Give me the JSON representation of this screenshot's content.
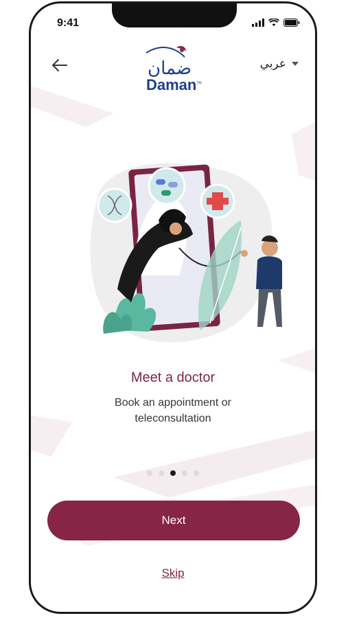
{
  "status_bar": {
    "time": "9:41",
    "icons": [
      "signal-icon",
      "wifi-icon",
      "battery-icon"
    ]
  },
  "header": {
    "back_icon": "arrow-left-icon",
    "logo": {
      "arabic": "ضمان",
      "english": "Daman",
      "trademark": "TM"
    },
    "language": {
      "label": "عربي",
      "icon": "caret-down-icon"
    }
  },
  "onboarding": {
    "illustration": "doctor-teleconsultation-illustration",
    "title": "Meet a doctor",
    "subtitle": "Book an appointment or teleconsultation",
    "pages_total": 5,
    "current_page": 3
  },
  "actions": {
    "next_label": "Next",
    "skip_label": "Skip"
  },
  "colors": {
    "brand_maroon": "#862545",
    "title_maroon": "#7b2748",
    "logo_blue": "#1e3f8a",
    "dot_inactive": "#dcdcdc",
    "dot_active": "#1a1a1a"
  }
}
